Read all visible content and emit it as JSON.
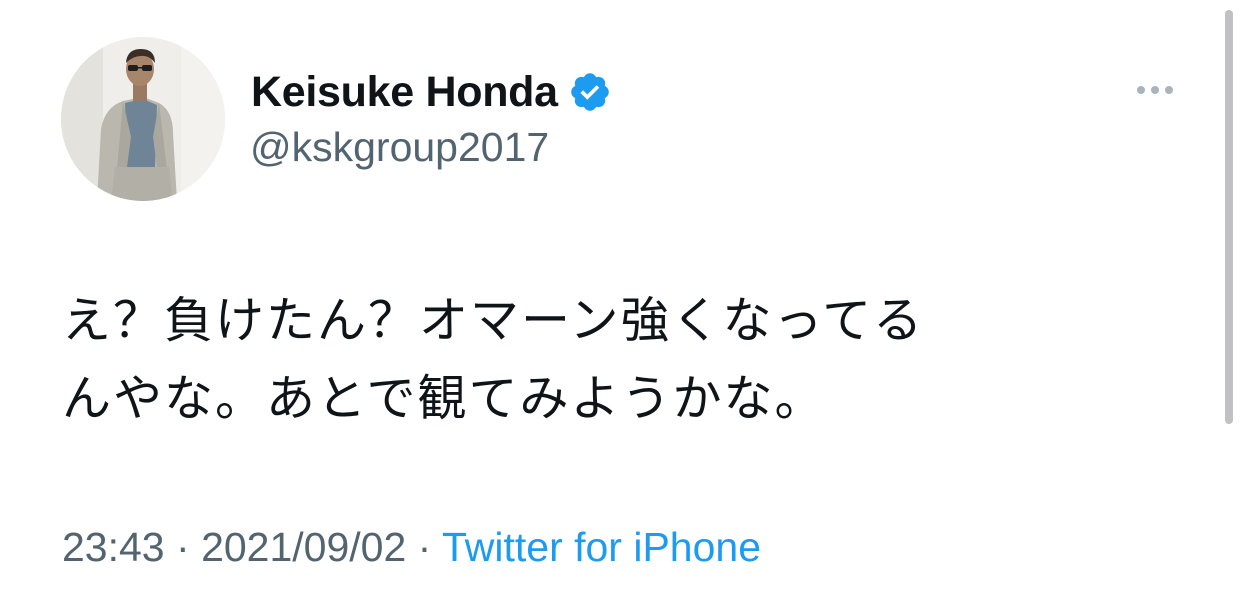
{
  "tweet": {
    "author": {
      "display_name": "Keisuke Honda",
      "handle": "@kskgroup2017",
      "verified": true,
      "avatar_icon": "profile-photo"
    },
    "text_line_1": "え？負けたん？オマーン強くなってる",
    "text_line_2": "んやな。あとで観てみようかな。",
    "time": "23:43",
    "separator": "·",
    "date": "2021/09/02",
    "source": "Twitter for iPhone",
    "more_icon": "ellipsis-icon"
  },
  "colors": {
    "verified_blue": "#1d9bf0",
    "link_blue": "#1d9bf0",
    "secondary_text": "#536471",
    "primary_text": "#0f1419"
  }
}
